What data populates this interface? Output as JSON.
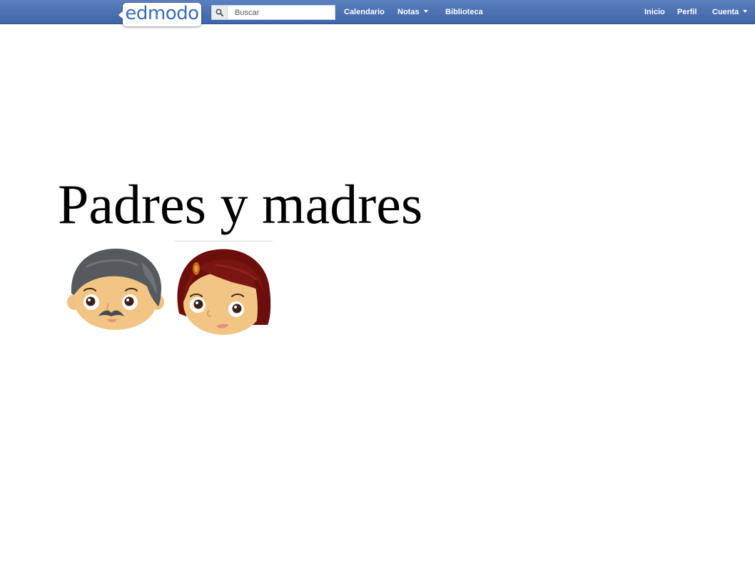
{
  "header": {
    "logo_text": "edmodo",
    "search": {
      "placeholder": "Buscar"
    },
    "nav_left": {
      "calendar": "Calendario",
      "notes": "Notas",
      "library": "Biblioteca"
    },
    "nav_right": {
      "home": "Inicio",
      "profile": "Perfil",
      "account": "Cuenta"
    },
    "colors": {
      "bar": "#4a70b0",
      "logo_text": "#3a6db5"
    }
  },
  "slide": {
    "title": "Padres y madres",
    "images": [
      {
        "icon": "father-face-icon"
      },
      {
        "icon": "mother-face-icon"
      }
    ]
  }
}
